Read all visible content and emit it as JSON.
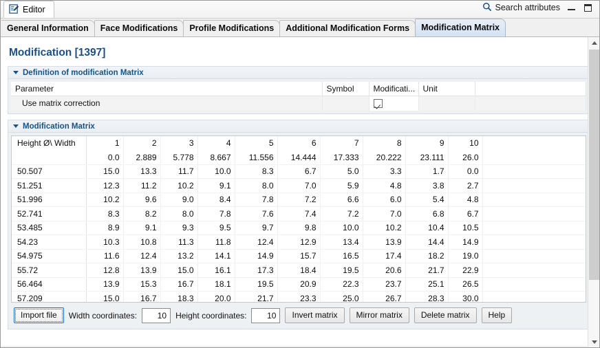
{
  "window": {
    "editor_tab_label": "Editor",
    "editor_tab_icon": "editor-pencil-icon",
    "search_label": "Search attributes",
    "search_icon": "magnifier-icon",
    "minimize_label": "Minimize",
    "maximize_label": "Maximize"
  },
  "form_tabs": [
    {
      "label": "General Information",
      "active": false
    },
    {
      "label": "Face Modifications",
      "active": false
    },
    {
      "label": "Profile Modifications",
      "active": false
    },
    {
      "label": "Additional Modification Forms",
      "active": false
    },
    {
      "label": "Modification Matrix",
      "active": true
    }
  ],
  "page": {
    "title": "Modification [1397]",
    "title_color": "#1b4f8a"
  },
  "definition_section": {
    "title": "Definition of modification Matrix",
    "expanded": true,
    "columns": [
      "Parameter",
      "Symbol",
      "Modificati...",
      "Unit",
      ""
    ],
    "rows": [
      {
        "parameter": "Use matrix correction",
        "symbol": "",
        "modification": "",
        "modification_checked": true,
        "unit": "",
        "extra": ""
      }
    ]
  },
  "matrix_section": {
    "title": "Modification Matrix",
    "expanded": true,
    "corner_label": "Height Ø\\ Width",
    "column_indices": [
      "1",
      "2",
      "3",
      "4",
      "5",
      "6",
      "7",
      "8",
      "9",
      "10"
    ],
    "column_values": [
      "0.0",
      "2.889",
      "5.778",
      "8.667",
      "11.556",
      "14.444",
      "17.333",
      "20.222",
      "23.111",
      "26.0"
    ],
    "row_headers": [
      "50.507",
      "51.251",
      "51.996",
      "52.741",
      "53.485",
      "54.23",
      "54.975",
      "55.72",
      "56.464",
      "57.209"
    ],
    "cells": [
      [
        "15.0",
        "13.3",
        "11.7",
        "10.0",
        "8.3",
        "6.7",
        "5.0",
        "3.3",
        "1.7",
        "0.0"
      ],
      [
        "12.3",
        "11.2",
        "10.2",
        "9.1",
        "8.0",
        "7.0",
        "5.9",
        "4.8",
        "3.8",
        "2.7"
      ],
      [
        "10.2",
        "9.6",
        "9.0",
        "8.4",
        "7.8",
        "7.2",
        "6.6",
        "6.0",
        "5.4",
        "4.8"
      ],
      [
        "8.3",
        "8.2",
        "8.0",
        "7.8",
        "7.6",
        "7.4",
        "7.2",
        "7.0",
        "6.8",
        "6.7"
      ],
      [
        "8.9",
        "9.1",
        "9.3",
        "9.5",
        "9.7",
        "9.8",
        "10.0",
        "10.2",
        "10.4",
        "10.5"
      ],
      [
        "10.3",
        "10.8",
        "11.3",
        "11.8",
        "12.4",
        "12.9",
        "13.4",
        "13.9",
        "14.4",
        "14.9"
      ],
      [
        "11.6",
        "12.4",
        "13.2",
        "14.1",
        "14.9",
        "15.7",
        "16.5",
        "17.4",
        "18.2",
        "19.0"
      ],
      [
        "12.8",
        "13.9",
        "15.0",
        "16.1",
        "17.3",
        "18.4",
        "19.5",
        "20.6",
        "21.7",
        "22.9"
      ],
      [
        "13.9",
        "15.3",
        "16.7",
        "18.1",
        "19.5",
        "20.9",
        "22.3",
        "23.7",
        "25.1",
        "26.5"
      ],
      [
        "15.0",
        "16.7",
        "18.3",
        "20.0",
        "21.7",
        "23.3",
        "25.0",
        "26.7",
        "28.3",
        "30.0"
      ]
    ]
  },
  "toolbar": {
    "import_file_label": "Import file",
    "width_coordinates_label": "Width coordinates:",
    "width_coordinates_value": "10",
    "height_coordinates_label": "Height coordinates:",
    "height_coordinates_value": "10",
    "invert_matrix_label": "Invert matrix",
    "mirror_matrix_label": "Mirror matrix",
    "delete_matrix_label": "Delete matrix",
    "help_label": "Help"
  }
}
